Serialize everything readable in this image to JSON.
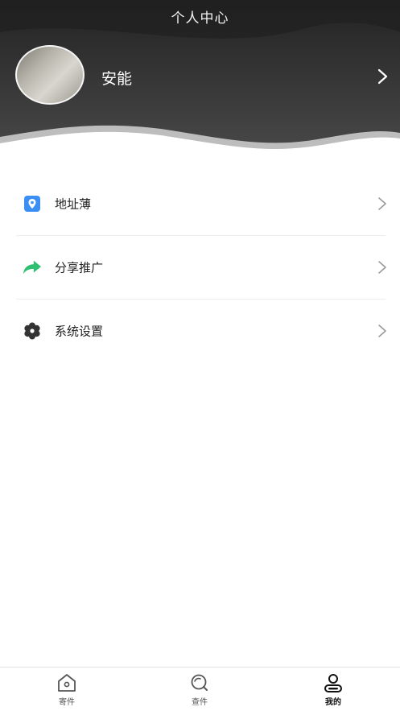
{
  "header": {
    "title": "个人中心",
    "username": "安能"
  },
  "menu": {
    "items": [
      {
        "label": "地址薄",
        "icon": "location-book-icon"
      },
      {
        "label": "分享推广",
        "icon": "share-arrow-icon"
      },
      {
        "label": "系统设置",
        "icon": "gear-icon"
      }
    ]
  },
  "tabbar": {
    "tabs": [
      {
        "label": "寄件",
        "icon": "home-icon",
        "active": false
      },
      {
        "label": "查件",
        "icon": "search-icon",
        "active": false
      },
      {
        "label": "我的",
        "icon": "user-icon",
        "active": true
      }
    ]
  },
  "colors": {
    "header_dark": "#2b2b2b",
    "accent_blue": "#3b8ff3",
    "accent_green": "#2fbf71",
    "gear_dark": "#333333"
  }
}
